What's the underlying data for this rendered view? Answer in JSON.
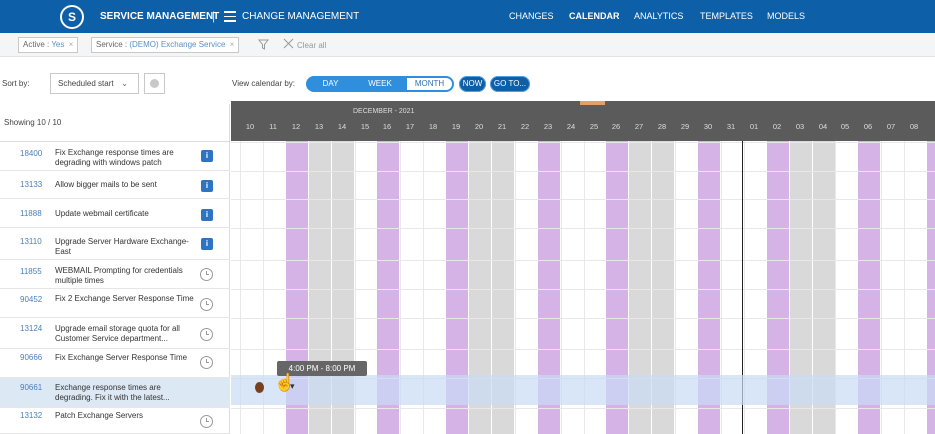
{
  "header": {
    "logo_glyph": "S",
    "brand": "SERVICE MANAGEMENT",
    "separator": "|",
    "module": "CHANGE MANAGEMENT",
    "nav": [
      "CHANGES",
      "CALENDAR",
      "ANALYTICS",
      "TEMPLATES",
      "MODELS"
    ],
    "active_nav": "CALENDAR"
  },
  "filters": {
    "active_label": "Active :",
    "active_value": "Yes",
    "service_label": "Service :",
    "service_value": "(DEMO) Exchange Service",
    "remove": "×",
    "clear_label": "Clear all"
  },
  "sort": {
    "label": "Sort by:",
    "value": "Scheduled start"
  },
  "view": {
    "label": "View calendar by:",
    "day": "DAY",
    "week": "WEEK",
    "month": "MONTH",
    "now": "NOW",
    "goto": "GO TO..."
  },
  "list": {
    "showing": "Showing 10 / 10",
    "items": [
      {
        "id": "18400",
        "title": "Fix Exchange response times are degrading with windows patch",
        "icon": "info-icon"
      },
      {
        "id": "13133",
        "title": "Allow bigger mails to be sent",
        "icon": "info-icon"
      },
      {
        "id": "11888",
        "title": "Update webmail certificate",
        "icon": "info-icon"
      },
      {
        "id": "13110",
        "title": "Upgrade Server Hardware Exchange-East",
        "icon": "info-icon"
      },
      {
        "id": "11855",
        "title": "WEBMAIL Prompting for credentials multiple times",
        "icon": "clock-icon"
      },
      {
        "id": "90452",
        "title": "Fix 2 Exchange Server Response Time",
        "icon": "clock-icon"
      },
      {
        "id": "13124",
        "title": "Upgrade email storage quota for all Customer Service department...",
        "icon": "clock-icon"
      },
      {
        "id": "90666",
        "title": "Fix Exchange Server Response Time",
        "icon": "clock-icon"
      },
      {
        "id": "90661",
        "title": "Exchange response times are degrading. Fix it with the latest...",
        "icon": "none"
      },
      {
        "id": "13132",
        "title": "Patch Exchange Servers",
        "icon": "clock-icon"
      }
    ]
  },
  "calendar": {
    "month_label": "DECEMBER - 2021",
    "days": [
      "10",
      "11",
      "12",
      "13",
      "14",
      "15",
      "16",
      "17",
      "18",
      "19",
      "20",
      "21",
      "22",
      "23",
      "24",
      "25",
      "26",
      "27",
      "28",
      "29",
      "30",
      "31",
      "01",
      "02",
      "03",
      "04",
      "05",
      "06",
      "07",
      "08",
      "0"
    ],
    "tooltip": "4:00 PM - 8:00 PM",
    "colors": {
      "header": "#5b5b5b",
      "weekend": "#d9d9d9",
      "highlight": "#d6b3e6",
      "selected_row": "#dde8f5",
      "accent": "#0d5fa8"
    }
  }
}
